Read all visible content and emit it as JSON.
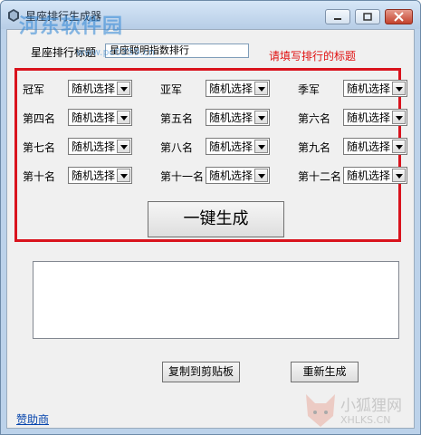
{
  "window": {
    "title": "星座排行生成器"
  },
  "form": {
    "title_label": "星座排行标题",
    "title_value": "星座聪明指数排行",
    "hint": "请填写排行的标题"
  },
  "ranks": [
    {
      "label": "冠军",
      "value": "随机选择"
    },
    {
      "label": "亚军",
      "value": "随机选择"
    },
    {
      "label": "季军",
      "value": "随机选择"
    },
    {
      "label": "第四名",
      "value": "随机选择"
    },
    {
      "label": "第五名",
      "value": "随机选择"
    },
    {
      "label": "第六名",
      "value": "随机选择"
    },
    {
      "label": "第七名",
      "value": "随机选择"
    },
    {
      "label": "第八名",
      "value": "随机选择"
    },
    {
      "label": "第九名",
      "value": "随机选择"
    },
    {
      "label": "第十名",
      "value": "随机选择"
    },
    {
      "label": "第十一名",
      "value": "随机选择"
    },
    {
      "label": "第十二名",
      "value": "随机选择"
    }
  ],
  "buttons": {
    "generate": "一键生成",
    "copy": "复制到剪贴板",
    "regenerate": "重新生成"
  },
  "output": {
    "value": ""
  },
  "footer": {
    "sponsor": "赞助商"
  },
  "watermarks": {
    "site_name": "河东软件园",
    "site_url": "www.pc0359.cn",
    "corner_brand": "小狐狸网",
    "corner_url": "XHLKS.CN"
  },
  "colors": {
    "highlight_border": "#d9131d",
    "hint_text": "#e01010",
    "link": "#0645ad"
  }
}
